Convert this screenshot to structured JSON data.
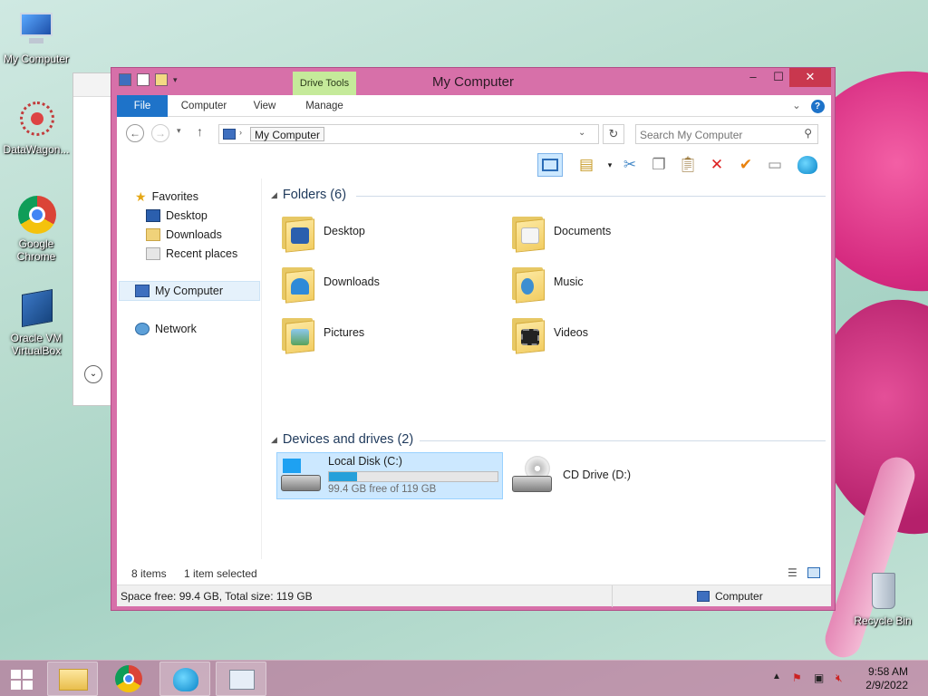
{
  "desktop": {
    "icons": [
      {
        "label_line1": "My Computer",
        "label_line2": ""
      },
      {
        "label_line1": "DataWagon...",
        "label_line2": ""
      },
      {
        "label_line1": "Google",
        "label_line2": "Chrome"
      },
      {
        "label_line1": "Oracle VM",
        "label_line2": "VirtualBox"
      },
      {
        "label_line1": "Recycle Bin",
        "label_line2": ""
      }
    ]
  },
  "window": {
    "title": "My Computer",
    "context_tab_group": "Drive Tools",
    "controls": {
      "minimize": "–",
      "maximize": "☐",
      "close": "✕"
    },
    "ribbon_tabs": [
      "File",
      "Computer",
      "View",
      "Manage"
    ],
    "address": {
      "crumb": "My Computer"
    },
    "search": {
      "placeholder": "Search My Computer"
    },
    "nav_pane": {
      "favorites": "Favorites",
      "favorites_items": [
        "Desktop",
        "Downloads",
        "Recent places"
      ],
      "computer": "My Computer",
      "network": "Network"
    },
    "groups": {
      "folders": "Folders (6)",
      "devices": "Devices and drives (2)"
    },
    "folders": [
      "Desktop",
      "Documents",
      "Downloads",
      "Music",
      "Pictures",
      "Videos"
    ],
    "drives": [
      {
        "name": "Local Disk (C:)",
        "free_text": "99.4 GB free of 119 GB",
        "used_fraction": 0.165
      },
      {
        "name": "CD Drive (D:)"
      }
    ],
    "status": {
      "items": "8 items",
      "selected": "1 item selected"
    },
    "details": {
      "space": "Space free: 99.4 GB, Total size: 119 GB",
      "location": "Computer"
    }
  },
  "taskbar": {
    "time": "9:58 AM",
    "date": "2/9/2022"
  },
  "colors": {
    "accent": "#1e73c9",
    "window_frame": "#d770a9",
    "drive_tools": "#c5ea9a"
  }
}
